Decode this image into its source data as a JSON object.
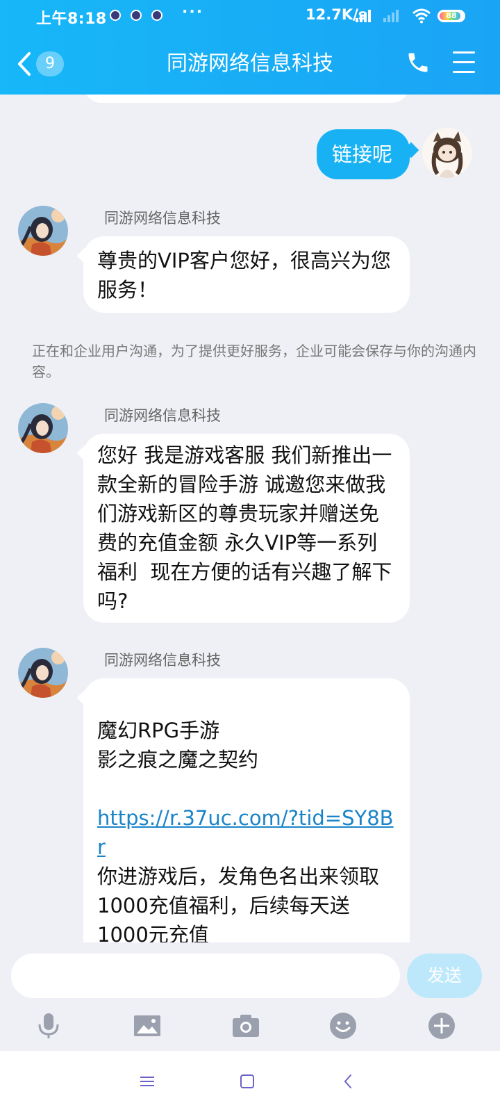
{
  "status": {
    "time": "上午8:18",
    "dots": "···",
    "speed": "12.7K/s",
    "battery": "88"
  },
  "header": {
    "back_badge": "9",
    "title": "同游网络信息科技"
  },
  "messages": {
    "sent_1": "链接呢",
    "sender": "同游网络信息科技",
    "recv_1": "尊贵的VIP客户您好，很高兴为您服务！",
    "notice": "正在和企业用户沟通，为了提供更好服务，企业可能会保存与你的沟通内容。",
    "recv_2": "您好 我是游戏客服 我们新推出一款全新的冒险手游 诚邀您来做我们游戏新区的尊贵玩家并赠送免费的充值金额 永久VIP等一系列福利  现在方便的话有兴趣了解下吗?",
    "recv_3_head": "魔幻RPG手游\n影之痕之魔之契约",
    "recv_3_link": "https://r.37uc.com/?tid=SY8Br",
    "recv_3_tail": "你进游戏后，发角色名出来领取1000充值福利，后续每天送1000元充值"
  },
  "input": {
    "placeholder": "",
    "send_label": "发送"
  },
  "colors": {
    "header": "#1aa4f5",
    "sent_bubble": "#18b2f4",
    "link": "#1a84c8",
    "send_button": "#bde8fb"
  },
  "icons": [
    "back-chevron-icon",
    "phone-icon",
    "menu-icon",
    "mic-icon",
    "image-icon",
    "camera-icon",
    "emoji-icon",
    "plus-icon"
  ]
}
